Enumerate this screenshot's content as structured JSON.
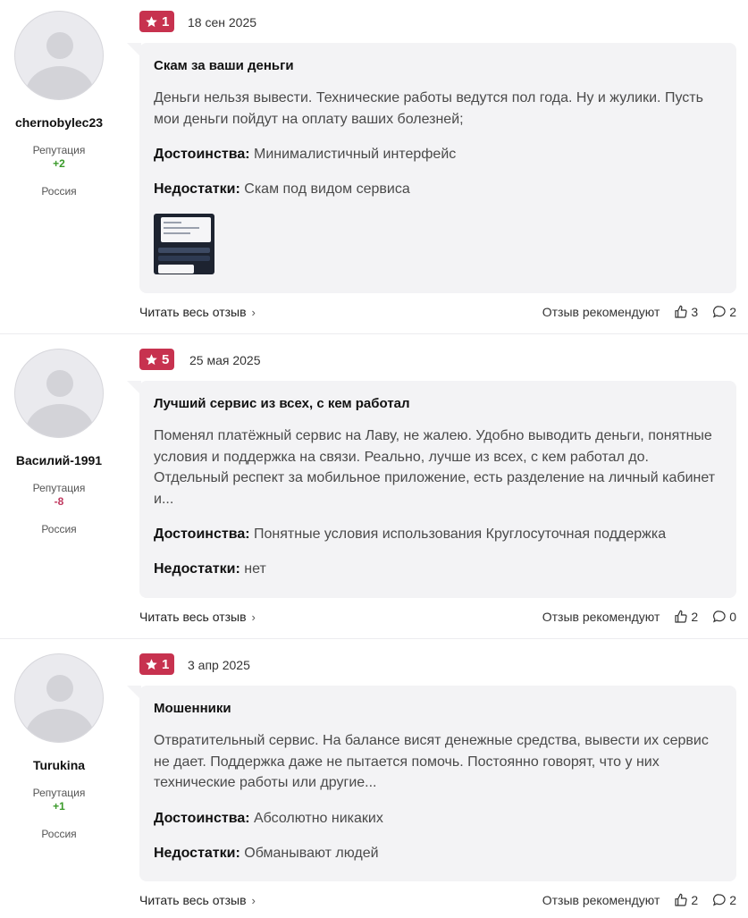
{
  "labels": {
    "reputation": "Репутация",
    "pros": "Достоинства:",
    "cons": "Недостатки:",
    "read_more": "Читать весь отзыв",
    "recommend": "Отзыв рекомендуют"
  },
  "colors": {
    "rating_badge": "#c7324f",
    "rep_positive": "#3a9a2a",
    "rep_negative": "#c0395f",
    "card_bg": "#f3f3f5"
  },
  "reviews": [
    {
      "rating": "1",
      "date": "18 сен 2025",
      "user": "chernobylec23",
      "reputation": "+2",
      "reputation_sign": "positive",
      "country": "Россия",
      "title": "Скам за ваши деньги",
      "text": "Деньги нельзя вывести. Технические работы ведутся пол года. Ну и жулики. Пусть мои деньги пойдут на оплату ваших болезней;",
      "pros": "Минималистичный интерфейс",
      "cons": "Скам под видом сервиса",
      "has_image": true,
      "likes": "3",
      "comments": "2"
    },
    {
      "rating": "5",
      "date": "25 мая 2025",
      "user": "Василий-1991",
      "reputation": "-8",
      "reputation_sign": "negative",
      "country": "Россия",
      "title": "Лучший сервис из всех, с кем работал",
      "text": "Поменял платёжный сервис на Лаву, не жалею. Удобно выводить деньги, понятные условия и поддержка на связи. Реально, лучше из всех, с кем работал до. Отдельный респект за мобильное приложение, есть разделение на личный кабинет и...",
      "pros": "Понятные условия использования Круглосуточная поддержка",
      "cons": "нет",
      "has_image": false,
      "likes": "2",
      "comments": "0"
    },
    {
      "rating": "1",
      "date": "3 апр 2025",
      "user": "Turukina",
      "reputation": "+1",
      "reputation_sign": "positive",
      "country": "Россия",
      "title": "Мошенники",
      "text": "Отвратительный сервис. На балансе висят денежные средства, вывести их сервис не дает. Поддержка даже не пытается помочь. Постоянно говорят, что у них технические работы или другие...",
      "pros": "Абсолютно никаких",
      "cons": "Обманывают людей",
      "has_image": false,
      "likes": "2",
      "comments": "2"
    }
  ]
}
